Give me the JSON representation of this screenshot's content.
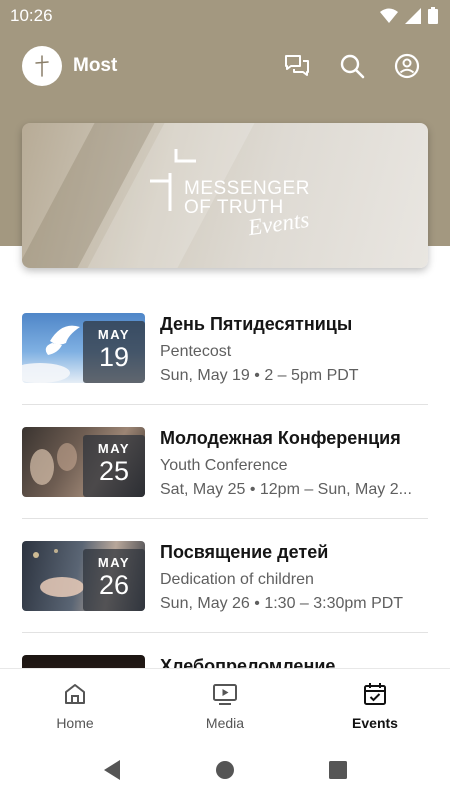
{
  "status_bar": {
    "time": "10:26",
    "icons": [
      "wifi-icon",
      "cellular-icon",
      "battery-icon"
    ]
  },
  "app_bar": {
    "title": "Most",
    "actions": [
      "chat-icon",
      "search-icon",
      "account-icon"
    ]
  },
  "banner": {
    "line1": "MESSENGER",
    "line2": "OF TRUTH",
    "script": "Events"
  },
  "events": [
    {
      "title": "День Пятидесятницы",
      "subtitle": "Pentecost",
      "when": "Sun, May 19 • 2 – 5pm PDT",
      "month": "MAY",
      "day": "19"
    },
    {
      "title": "Молодежная Конференция",
      "subtitle": "Youth Conference",
      "when": "Sat, May 25 • 12pm – Sun, May 2...",
      "month": "MAY",
      "day": "25"
    },
    {
      "title": "Посвящение детей",
      "subtitle": "Dedication of children",
      "when": "Sun, May 26 • 1:30 – 3:30pm PDT",
      "month": "MAY",
      "day": "26"
    },
    {
      "title": "Хлебопреломление",
      "subtitle": "",
      "when": "",
      "month": "",
      "day": ""
    }
  ],
  "bottom_nav": {
    "items": [
      {
        "label": "Home",
        "icon": "home-icon",
        "active": false
      },
      {
        "label": "Media",
        "icon": "media-icon",
        "active": false
      },
      {
        "label": "Events",
        "icon": "calendar-icon",
        "active": true
      }
    ]
  },
  "colors": {
    "header": "#a39880",
    "accent": "#111111",
    "muted_text": "#5f5f5f"
  }
}
